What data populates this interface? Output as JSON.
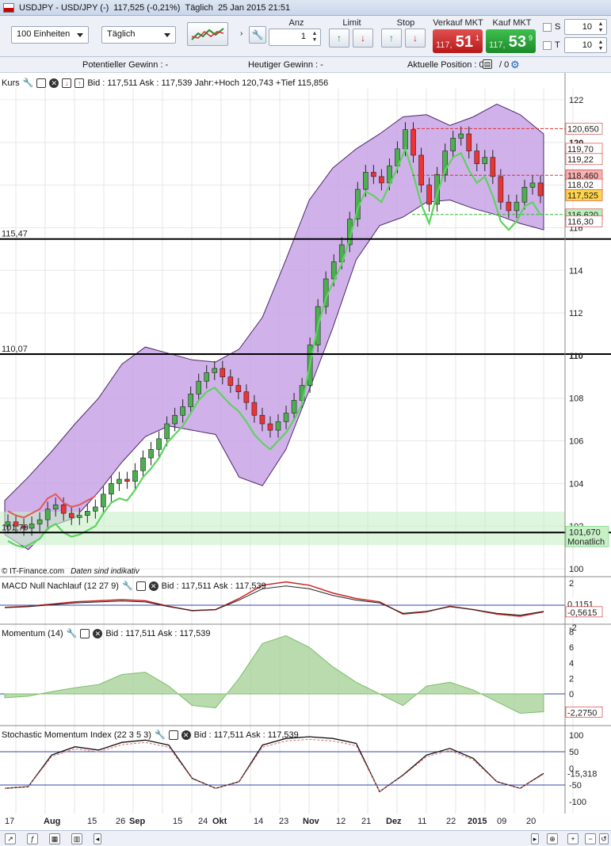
{
  "window": {
    "symbol": "USDJPY - USD/JPY (-)",
    "quote": "117,525 (-0,21%)",
    "period": "Täglich",
    "datetime": "25 Jan 2015 21:51"
  },
  "toolbar": {
    "units": "100 Einheiten",
    "interval": "Täglich",
    "anz_label": "Anz",
    "anz_value": "1",
    "limit_label": "Limit",
    "stop_label": "Stop",
    "sell_label": "Verkauf MKT",
    "buy_label": "Kauf MKT",
    "sell_small": "117,",
    "sell_big": "51",
    "sell_sup": "1",
    "buy_small": "117,",
    "buy_big": "53",
    "buy_sup": "9",
    "s_label": "S",
    "s_value": "10",
    "t_label": "T",
    "t_value": "10"
  },
  "info": {
    "potential": "Potentieller Gewinn : -",
    "today": "Heutiger Gewinn : -",
    "position": "Aktuelle Position : 0",
    "position_suffix": "/ 0"
  },
  "panels": {
    "price": {
      "name": "Kurs",
      "info": "Bid : 117,511 Ask : 117,539 Jahr:+Hoch 120,743 +Tief 115,856"
    },
    "macd": {
      "name": "MACD Null Nachlauf (12 27 9)",
      "info": "Bid : 117,511 Ask : 117,539"
    },
    "momentum": {
      "name": "Momentum (14)",
      "info": "Bid : 117,511 Ask : 117,539"
    },
    "stoch": {
      "name": "Stochastic Momentum Index (22 3 5 3)",
      "info": "Bid : 117,511 Ask : 117,539"
    }
  },
  "credit": "© IT-Finance.com",
  "credit_note": "Daten sind indikativ",
  "price_axis": [
    "122",
    "120",
    "118",
    "116",
    "114",
    "112",
    "110",
    "108",
    "106",
    "104",
    "102",
    "100"
  ],
  "price_tags": {
    "r1": "120,650",
    "r2": "119,70",
    "r3": "119,22",
    "r4": "118,460",
    "r5": "118,02",
    "cur": "117,525",
    "g1": "116,620",
    "g2": "116,30",
    "hz1": "115,47",
    "hz2": "110,07",
    "hz3": "101,70",
    "hz3_right": "101,670",
    "hz3_sub": "Monatlich"
  },
  "macd_axis": [
    "2",
    "0",
    "-2"
  ],
  "macd_tags": {
    "a": "0,1151",
    "b": "-0,5615"
  },
  "mom_axis": [
    "8",
    "6",
    "4",
    "2",
    "0",
    "-2"
  ],
  "mom_tag": "-2,2750",
  "stoch_axis": [
    "100",
    "50",
    "0",
    "-50",
    "-100"
  ],
  "stoch_tag": "-15,318",
  "date_axis": [
    "17",
    "Aug",
    "15",
    "26",
    "Sep",
    "15",
    "24",
    "Okt",
    "14",
    "23",
    "Nov",
    "12",
    "21",
    "Dez",
    "11",
    "22",
    "2015",
    "09",
    "20"
  ],
  "chart_data": {
    "type": "candlestick",
    "ylim": [
      100,
      123
    ],
    "ohlc_close_approx": [
      102.2,
      102.0,
      101.9,
      102.1,
      102.3,
      102.8,
      103.0,
      102.6,
      102.4,
      102.5,
      102.7,
      102.9,
      103.5,
      104.0,
      104.2,
      104.1,
      104.6,
      105.2,
      105.6,
      106.1,
      106.8,
      107.2,
      107.6,
      108.2,
      108.8,
      109.2,
      109.4,
      109.0,
      108.6,
      108.3,
      107.8,
      107.2,
      106.8,
      106.5,
      106.9,
      107.3,
      107.9,
      108.6,
      110.5,
      112.3,
      113.6,
      114.4,
      115.2,
      116.4,
      117.8,
      118.6,
      118.4,
      118.1,
      118.9,
      119.7,
      120.6,
      119.4,
      118.0,
      117.1,
      118.5,
      119.6,
      120.2,
      120.4,
      119.6,
      119.0,
      119.3,
      118.4,
      117.2,
      116.8,
      117.2,
      117.9,
      118.1,
      117.5
    ],
    "bb_upper_approx": [
      103.2,
      104.3,
      105.5,
      106.8,
      108.0,
      109.6,
      110.4,
      110.1,
      109.8,
      109.7,
      110.3,
      111.8,
      114.5,
      117.3,
      118.8,
      119.7,
      120.4,
      121.2,
      121.3,
      120.8,
      121.2,
      121.8,
      121.3,
      120.4
    ],
    "bb_lower_approx": [
      101.6,
      100.9,
      102.0,
      102.4,
      103.6,
      105.0,
      106.2,
      106.7,
      106.5,
      106.3,
      104.3,
      103.9,
      105.6,
      108.4,
      111.3,
      114.5,
      116.1,
      116.5,
      117.2,
      117.3,
      116.9,
      116.6,
      116.2,
      115.9
    ]
  }
}
